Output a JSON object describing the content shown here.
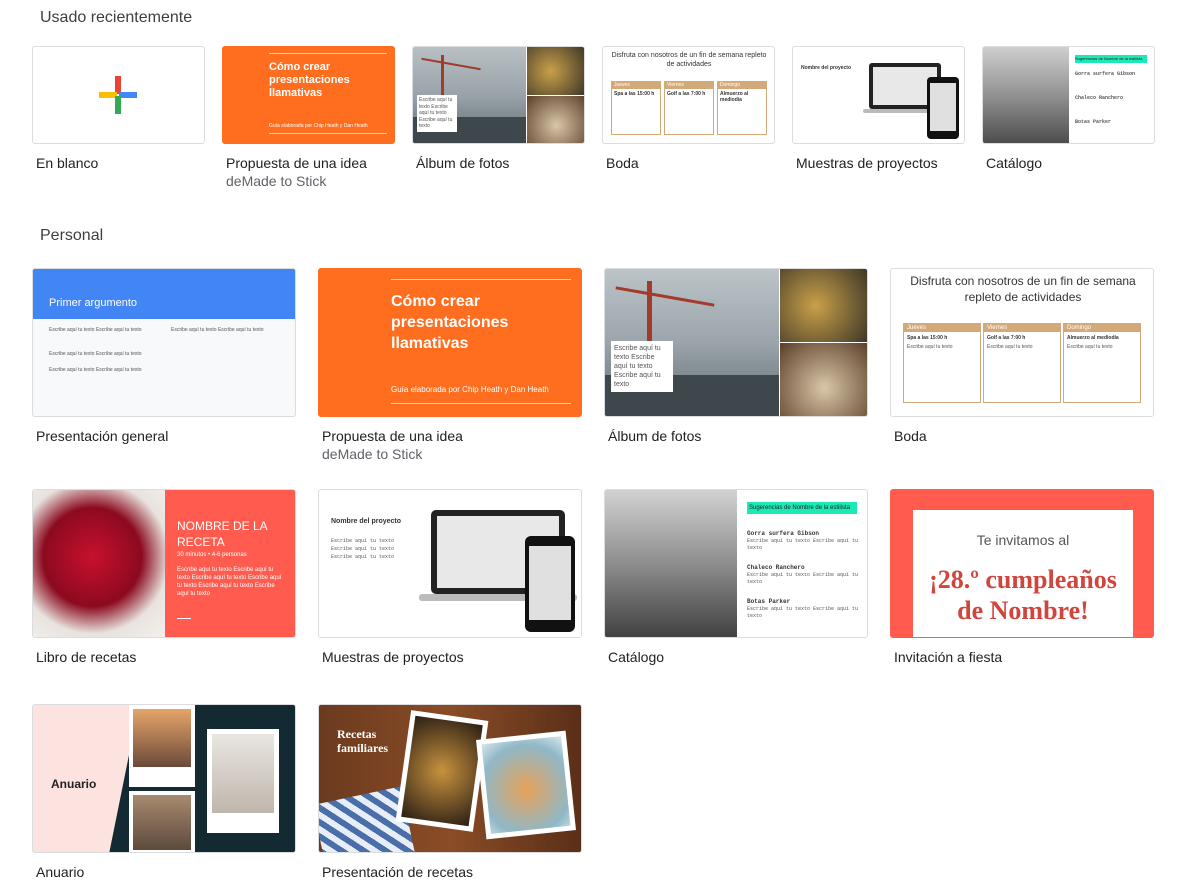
{
  "sections": {
    "recent": "Usado recientemente",
    "personal": "Personal"
  },
  "recent": [
    {
      "label": "En blanco",
      "sub": ""
    },
    {
      "label": "Propuesta de una idea",
      "sub": "deMade to Stick"
    },
    {
      "label": "Álbum de fotos",
      "sub": ""
    },
    {
      "label": "Boda",
      "sub": ""
    },
    {
      "label": "Muestras de proyectos",
      "sub": ""
    },
    {
      "label": "Catálogo",
      "sub": ""
    }
  ],
  "personal": [
    {
      "label": "Presentación general",
      "sub": ""
    },
    {
      "label": "Propuesta de una idea",
      "sub": "deMade to Stick"
    },
    {
      "label": "Álbum de fotos",
      "sub": ""
    },
    {
      "label": "Boda",
      "sub": ""
    },
    {
      "label": "Libro de recetas",
      "sub": ""
    },
    {
      "label": "Muestras de proyectos",
      "sub": ""
    },
    {
      "label": "Catálogo",
      "sub": ""
    },
    {
      "label": "Invitación a fiesta",
      "sub": ""
    },
    {
      "label": "Anuario",
      "sub": ""
    },
    {
      "label": "Presentación de recetas",
      "sub": ""
    }
  ],
  "thumbs": {
    "idea_title": "Cómo crear presentaciones llamativas",
    "idea_sub": "Guía elaborada por Chip Heath y Dan Heath",
    "album_text": "Escribe aquí tu texto Escribe aquí tu texto Escribe aquí tu texto",
    "boda_title": "Disfruta con nosotros de un fin de semana repleto de actividades",
    "boda_days": [
      "Jueves",
      "Viernes",
      "Domingo"
    ],
    "boda_heads": [
      "Spa a las 15:00 h",
      "Golf a las 7:00 h",
      "Almuerzo al mediodía"
    ],
    "boda_line": "Escribe aquí tu texto",
    "proj_title": "Nombre del proyecto",
    "mono_line": "Escribe aquí tu texto",
    "cat_header": "Sugerencias de Nombre de la estilista",
    "cat_items": [
      "Gorra surfera Gibson",
      "Chaleco Ranchero",
      "Botas Parker"
    ],
    "cat_line": "Escribe aquí tu texto Escribe aquí tu texto",
    "gen_title": "Primer argumento",
    "gen_line": "Escribe aquí tu texto Escribe aquí tu texto",
    "receta_title": "NOMBRE DE LA RECETA",
    "receta_meta": "30 minutos • 4-6 personas",
    "receta_text": "Escribe aquí tu texto Escribe aquí tu texto Escribe aquí tu texto Escribe aquí tu texto Escribe aquí tu texto Escribe aquí tu texto",
    "fiesta_top": "Te invitamos al",
    "fiesta_main": "¡28.º cumpleaños de Nombre!",
    "anuario_title": "Anuario",
    "recetas_title": "Recetas familiares"
  }
}
